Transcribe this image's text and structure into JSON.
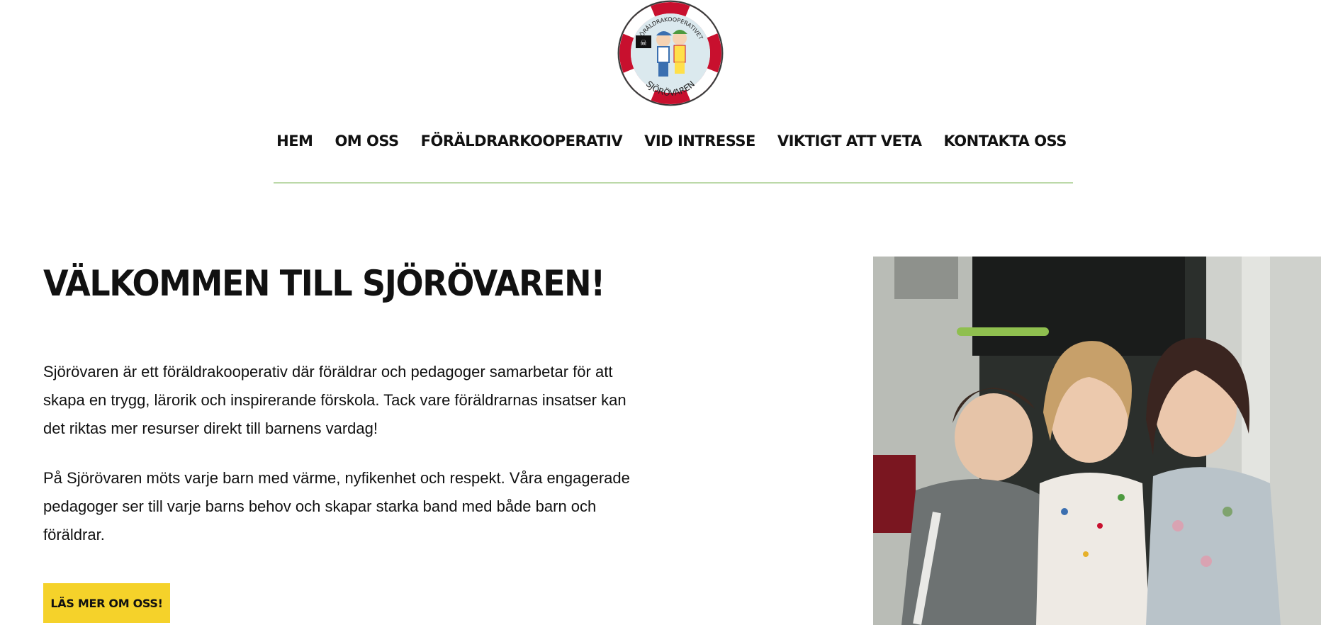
{
  "logo": {
    "top_text": "FÖRÄLDRAKOOPERATIVET",
    "bottom_text": "SJÖRÖVAREN"
  },
  "nav": {
    "items": [
      {
        "label": "HEM"
      },
      {
        "label": "OM OSS"
      },
      {
        "label": "FÖRÄLDRARKOOPERATIV"
      },
      {
        "label": "VID INTRESSE"
      },
      {
        "label": "VIKTIGT ATT VETA"
      },
      {
        "label": "KONTAKTA OSS"
      }
    ]
  },
  "hero": {
    "title": "VÄLKOMMEN TILL SJÖRÖVAREN!",
    "paragraph1": "Sjörövaren är ett föräldrakooperativ där föräldrar och pedagoger samarbetar för att skapa en trygg, lärorik och inspirerande förskola. Tack vare föräldrarnas insatser kan det riktas mer resurser direkt till barnens vardag!",
    "paragraph2": "På Sjörövaren möts varje barn med värme, nyfikenhet och respekt. Våra engagerade pedagoger ser till varje barns behov och skapar starka band med både barn och föräldrar.",
    "cta_label": "LÄS MER OM OSS!"
  },
  "colors": {
    "accent_button": "#f5d22a",
    "divider": "#bcd9a8",
    "logo_ring_red": "#c8102e"
  }
}
